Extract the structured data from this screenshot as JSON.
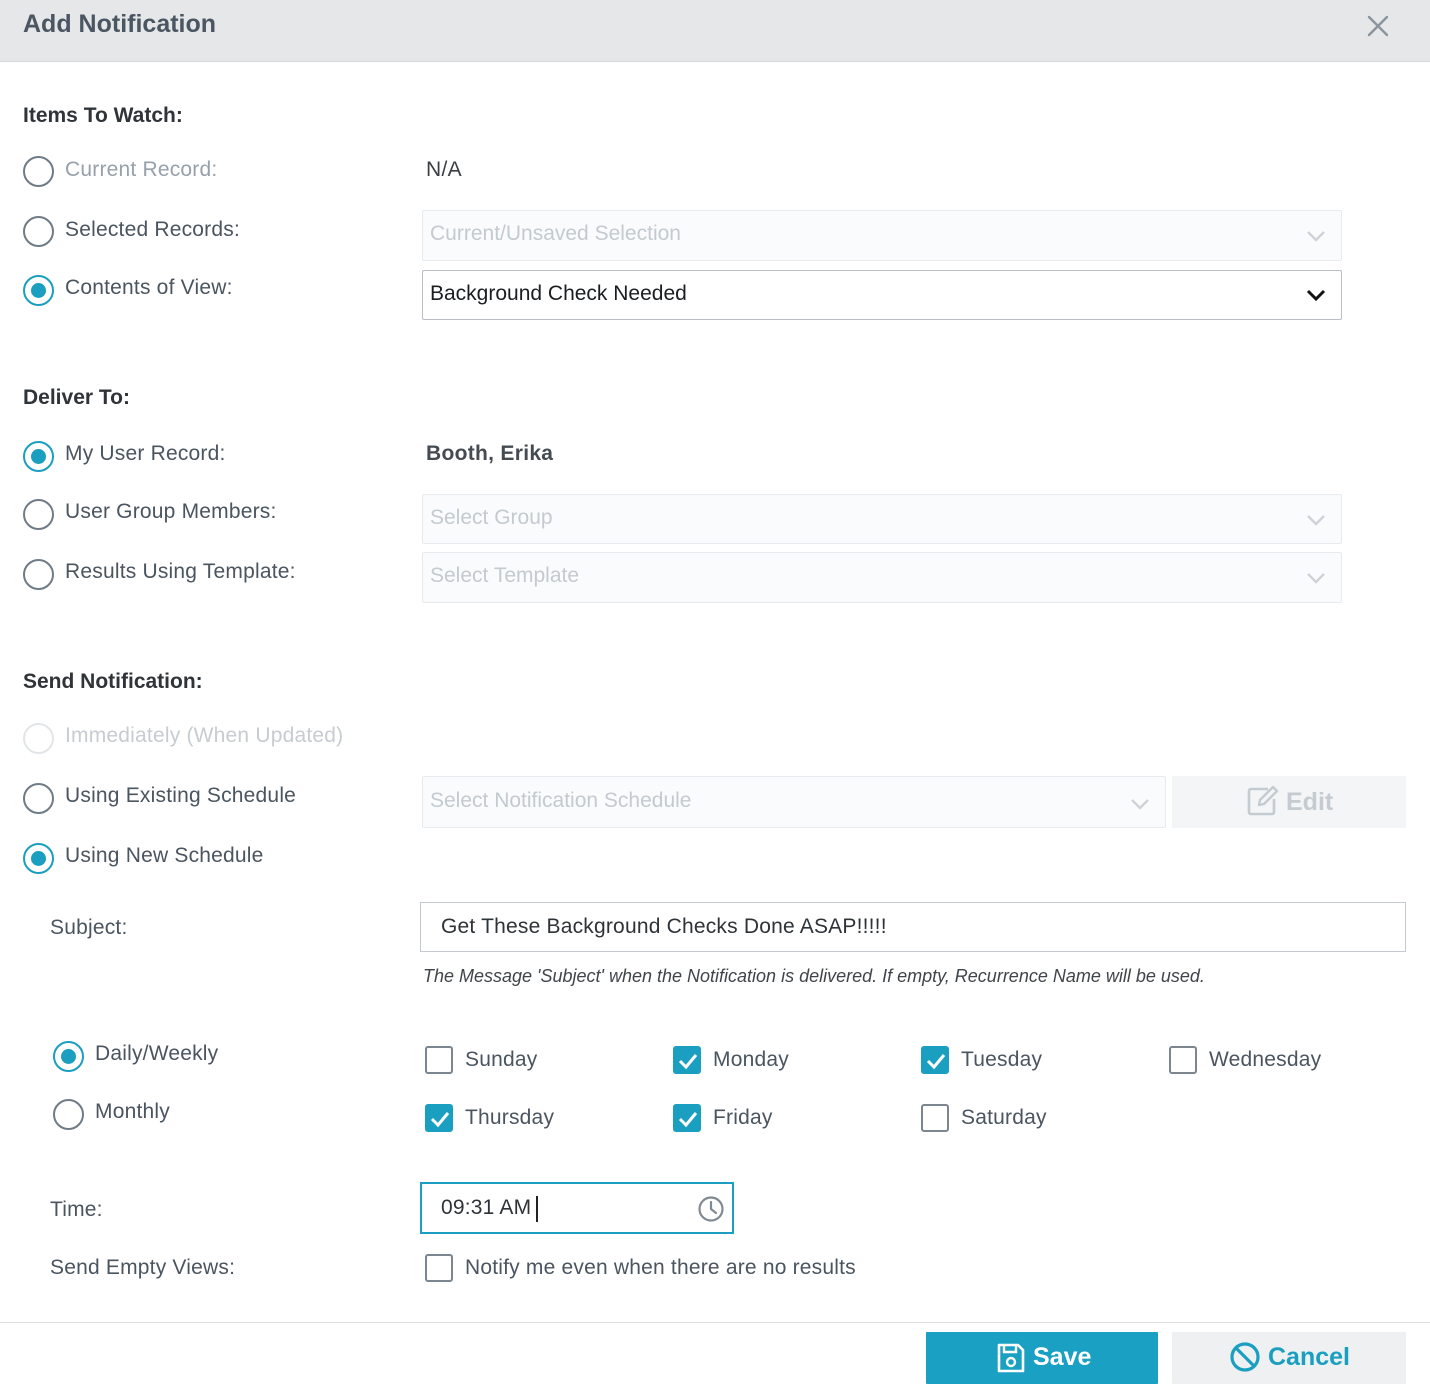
{
  "dialog": {
    "title": "Add Notification"
  },
  "items_to_watch": {
    "title": "Items To Watch:",
    "current_record": {
      "label": "Current Record:",
      "value": "N/A"
    },
    "selected_records": {
      "label": "Selected Records:",
      "placeholder": "Current/Unsaved Selection"
    },
    "contents_of_view": {
      "label": "Contents of View:",
      "value": "Background Check Needed"
    }
  },
  "deliver_to": {
    "title": "Deliver To:",
    "my_user_record": {
      "label": "My User Record:",
      "value": "Booth, Erika"
    },
    "user_group_members": {
      "label": "User Group Members:",
      "placeholder": "Select Group"
    },
    "results_using_template": {
      "label": "Results Using Template:",
      "placeholder": "Select Template"
    }
  },
  "send_notification": {
    "title": "Send Notification:",
    "immediately": {
      "label": "Immediately (When Updated)"
    },
    "existing_schedule": {
      "label": "Using Existing Schedule",
      "placeholder": "Select Notification Schedule",
      "edit_label": "Edit"
    },
    "new_schedule": {
      "label": "Using New Schedule"
    }
  },
  "schedule": {
    "subject_label": "Subject:",
    "subject_value": "Get These Background Checks Done ASAP!!!!!",
    "subject_hint": "The Message 'Subject' when the Notification is delivered. If empty, Recurrence Name will be used.",
    "daily_weekly_label": "Daily/Weekly",
    "monthly_label": "Monthly",
    "days": [
      {
        "label": "Sunday",
        "checked": false
      },
      {
        "label": "Monday",
        "checked": true
      },
      {
        "label": "Tuesday",
        "checked": true
      },
      {
        "label": "Wednesday",
        "checked": false
      },
      {
        "label": "Thursday",
        "checked": true
      },
      {
        "label": "Friday",
        "checked": true
      },
      {
        "label": "Saturday",
        "checked": false
      }
    ],
    "time_label": "Time:",
    "time_value": "09:31 AM",
    "send_empty_label": "Send Empty Views:",
    "send_empty_option": "Notify me even when there are no results"
  },
  "footer": {
    "save_label": "Save",
    "cancel_label": "Cancel"
  },
  "colors": {
    "accent": "#1a9fc0",
    "header_bg": "#e6e7e8"
  },
  "icons": [
    "close-icon",
    "chevron-down-icon",
    "edit-icon",
    "clock-icon",
    "checkmark-icon",
    "save-icon",
    "cancel-icon"
  ]
}
